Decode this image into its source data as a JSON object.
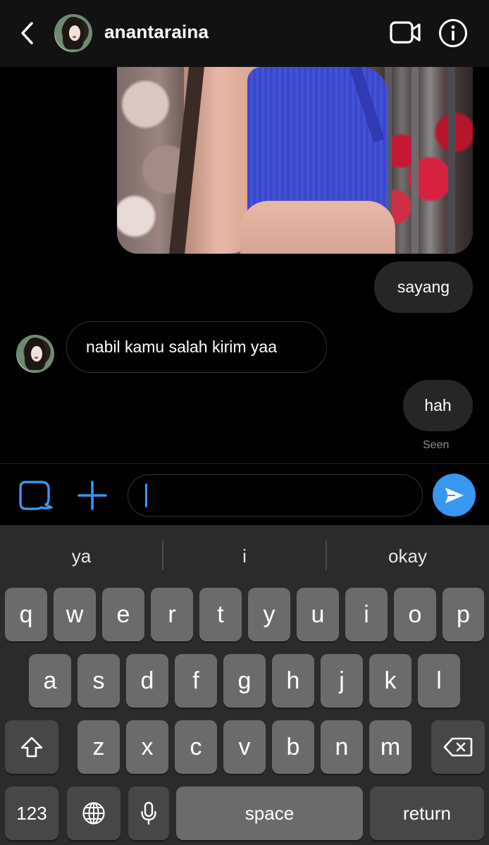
{
  "header": {
    "back_icon": "chevron-left-icon",
    "username": "anantaraina",
    "video_icon": "video-camera-icon",
    "info_icon": "info-icon"
  },
  "messages": [
    {
      "type": "image",
      "direction": "outgoing"
    },
    {
      "type": "text",
      "direction": "outgoing",
      "text": "sayang"
    },
    {
      "type": "text",
      "direction": "incoming",
      "text": "nabil kamu salah kirim yaa"
    },
    {
      "type": "text",
      "direction": "outgoing",
      "text": "hah"
    }
  ],
  "status": {
    "seen": "Seen"
  },
  "composer": {
    "sticker_icon": "sticker-icon",
    "plus_icon": "plus-icon",
    "input_value": "",
    "send_icon": "send-icon"
  },
  "keyboard": {
    "suggestions": [
      "ya",
      "i",
      "okay"
    ],
    "row1": [
      "q",
      "w",
      "e",
      "r",
      "t",
      "y",
      "u",
      "i",
      "o",
      "p"
    ],
    "row2": [
      "a",
      "s",
      "d",
      "f",
      "g",
      "h",
      "j",
      "k",
      "l"
    ],
    "row3": [
      "z",
      "x",
      "c",
      "v",
      "b",
      "n",
      "m"
    ],
    "shift_icon": "shift-icon",
    "delete_icon": "backspace-icon",
    "numbers_label": "123",
    "globe_icon": "globe-icon",
    "mic_icon": "microphone-icon",
    "space_label": "space",
    "return_label": "return"
  },
  "colors": {
    "accent": "#3897f0",
    "background": "#000000",
    "header_bg": "#121212",
    "bubble_outgoing": "#262626",
    "keyboard_bg": "#2b2b2b",
    "key_bg": "#6b6b6b",
    "key_dark_bg": "#474747"
  }
}
